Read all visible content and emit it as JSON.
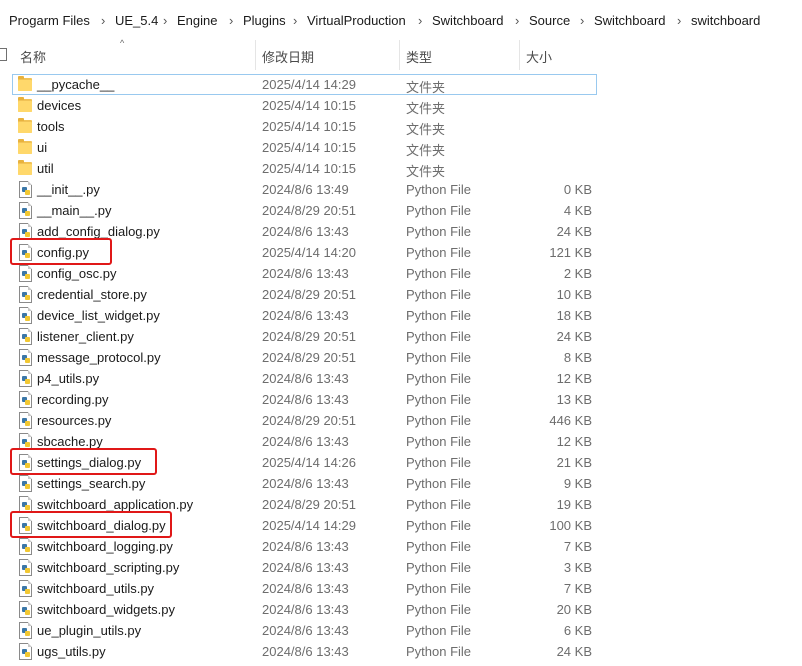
{
  "breadcrumb": [
    "Progarm Files",
    "UE_5.4",
    "Engine",
    "Plugins",
    "VirtualProduction",
    "Switchboard",
    "Source",
    "Switchboard",
    "switchboard"
  ],
  "columns": {
    "name": "名称",
    "date": "修改日期",
    "type": "类型",
    "size": "大小"
  },
  "sort_indicator": "^",
  "files": [
    {
      "name": "__pycache__",
      "date": "2025/4/14 14:29",
      "type": "文件夹",
      "size": "",
      "kind": "folder",
      "selected": true
    },
    {
      "name": "devices",
      "date": "2025/4/14 10:15",
      "type": "文件夹",
      "size": "",
      "kind": "folder"
    },
    {
      "name": "tools",
      "date": "2025/4/14 10:15",
      "type": "文件夹",
      "size": "",
      "kind": "folder"
    },
    {
      "name": "ui",
      "date": "2025/4/14 10:15",
      "type": "文件夹",
      "size": "",
      "kind": "folder"
    },
    {
      "name": "util",
      "date": "2025/4/14 10:15",
      "type": "文件夹",
      "size": "",
      "kind": "folder"
    },
    {
      "name": "__init__.py",
      "date": "2024/8/6 13:49",
      "type": "Python File",
      "size": "0 KB",
      "kind": "py"
    },
    {
      "name": "__main__.py",
      "date": "2024/8/29 20:51",
      "type": "Python File",
      "size": "4 KB",
      "kind": "py"
    },
    {
      "name": "add_config_dialog.py",
      "date": "2024/8/6 13:43",
      "type": "Python File",
      "size": "24 KB",
      "kind": "py"
    },
    {
      "name": "config.py",
      "date": "2025/4/14 14:20",
      "type": "Python File",
      "size": "121 KB",
      "kind": "py",
      "highlighted": true
    },
    {
      "name": "config_osc.py",
      "date": "2024/8/6 13:43",
      "type": "Python File",
      "size": "2 KB",
      "kind": "py"
    },
    {
      "name": "credential_store.py",
      "date": "2024/8/29 20:51",
      "type": "Python File",
      "size": "10 KB",
      "kind": "py"
    },
    {
      "name": "device_list_widget.py",
      "date": "2024/8/6 13:43",
      "type": "Python File",
      "size": "18 KB",
      "kind": "py"
    },
    {
      "name": "listener_client.py",
      "date": "2024/8/29 20:51",
      "type": "Python File",
      "size": "24 KB",
      "kind": "py"
    },
    {
      "name": "message_protocol.py",
      "date": "2024/8/29 20:51",
      "type": "Python File",
      "size": "8 KB",
      "kind": "py"
    },
    {
      "name": "p4_utils.py",
      "date": "2024/8/6 13:43",
      "type": "Python File",
      "size": "12 KB",
      "kind": "py"
    },
    {
      "name": "recording.py",
      "date": "2024/8/6 13:43",
      "type": "Python File",
      "size": "13 KB",
      "kind": "py"
    },
    {
      "name": "resources.py",
      "date": "2024/8/29 20:51",
      "type": "Python File",
      "size": "446 KB",
      "kind": "py"
    },
    {
      "name": "sbcache.py",
      "date": "2024/8/6 13:43",
      "type": "Python File",
      "size": "12 KB",
      "kind": "py"
    },
    {
      "name": "settings_dialog.py",
      "date": "2025/4/14 14:26",
      "type": "Python File",
      "size": "21 KB",
      "kind": "py",
      "highlighted": true
    },
    {
      "name": "settings_search.py",
      "date": "2024/8/6 13:43",
      "type": "Python File",
      "size": "9 KB",
      "kind": "py"
    },
    {
      "name": "switchboard_application.py",
      "date": "2024/8/29 20:51",
      "type": "Python File",
      "size": "19 KB",
      "kind": "py"
    },
    {
      "name": "switchboard_dialog.py",
      "date": "2025/4/14 14:29",
      "type": "Python File",
      "size": "100 KB",
      "kind": "py",
      "highlighted": true
    },
    {
      "name": "switchboard_logging.py",
      "date": "2024/8/6 13:43",
      "type": "Python File",
      "size": "7 KB",
      "kind": "py"
    },
    {
      "name": "switchboard_scripting.py",
      "date": "2024/8/6 13:43",
      "type": "Python File",
      "size": "3 KB",
      "kind": "py"
    },
    {
      "name": "switchboard_utils.py",
      "date": "2024/8/6 13:43",
      "type": "Python File",
      "size": "7 KB",
      "kind": "py"
    },
    {
      "name": "switchboard_widgets.py",
      "date": "2024/8/6 13:43",
      "type": "Python File",
      "size": "20 KB",
      "kind": "py"
    },
    {
      "name": "ue_plugin_utils.py",
      "date": "2024/8/6 13:43",
      "type": "Python File",
      "size": "6 KB",
      "kind": "py"
    },
    {
      "name": "ugs_utils.py",
      "date": "2024/8/6 13:43",
      "type": "Python File",
      "size": "24 KB",
      "kind": "py"
    }
  ],
  "colors": {
    "highlight": "#e01818",
    "selection_border": "#99c9ef",
    "folder": "#ffd86b",
    "python_blue": "#3b77a8",
    "python_yellow": "#f2c832"
  }
}
